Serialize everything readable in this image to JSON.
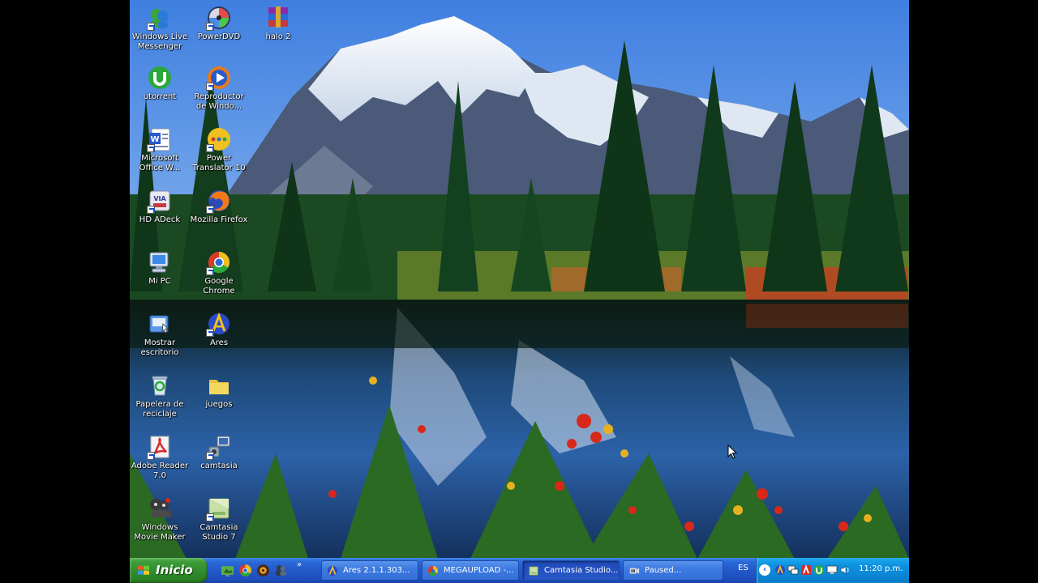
{
  "desktop": {
    "icons": [
      {
        "label": "Windows Live Messenger",
        "icon": "messenger-icon"
      },
      {
        "label": "PowerDVD",
        "icon": "powerdvd-icon"
      },
      {
        "label": "halo 2",
        "icon": "winrar-icon"
      },
      {
        "label": "utorrent",
        "icon": "utorrent-icon"
      },
      {
        "label": "Reproductor de Windo...",
        "icon": "media-player-icon"
      },
      {
        "label": "Microsoft Office W...",
        "icon": "word-icon"
      },
      {
        "label": "Power Translator 10",
        "icon": "translator-icon"
      },
      {
        "label": "HD ADeck",
        "icon": "hd-adeck-icon"
      },
      {
        "label": "Mozilla Firefox",
        "icon": "firefox-icon"
      },
      {
        "label": "Mi PC",
        "icon": "computer-icon"
      },
      {
        "label": "Google Chrome",
        "icon": "chrome-icon"
      },
      {
        "label": "Mostrar escritorio",
        "icon": "show-desktop-icon"
      },
      {
        "label": "Ares",
        "icon": "ares-icon"
      },
      {
        "label": "Papelera de reciclaje",
        "icon": "recycle-bin-icon"
      },
      {
        "label": "juegos",
        "icon": "folder-icon"
      },
      {
        "label": "Adobe Reader 7.0",
        "icon": "adobe-reader-icon"
      },
      {
        "label": "camtasia",
        "icon": "camtasia-icon"
      },
      {
        "label": "Windows Movie Maker",
        "icon": "movie-maker-icon"
      },
      {
        "label": "Camtasia Studio 7",
        "icon": "camtasia-studio-icon"
      }
    ]
  },
  "taskbar": {
    "start_label": "Inicio",
    "quick_launch": [
      "show-desktop-icon",
      "chrome-icon",
      "app-icon",
      "messenger-icon"
    ],
    "quick_launch_more": "»",
    "tasks": [
      {
        "label": "Ares 2.1.1.303...",
        "icon": "ares-icon"
      },
      {
        "label": "MEGAUPLOAD -...",
        "icon": "chrome-icon"
      },
      {
        "label": "Camtasia Studio...",
        "icon": "camtasia-icon"
      },
      {
        "label": "Paused...",
        "icon": "recorder-icon"
      }
    ],
    "language": "ES",
    "tray_toggle": "‹",
    "clock": "11:20 p.m."
  },
  "colors": {
    "taskbar": "#2458c8",
    "start_button": "#3c9a37",
    "tray": "#0b86d4"
  }
}
